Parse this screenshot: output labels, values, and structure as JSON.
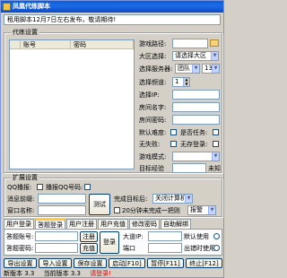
{
  "window": {
    "title": "凤凰代练脚本"
  },
  "notice": "租用脚本12月7日左右发布，敬请期待!",
  "daily_group": {
    "legend": "代练设置",
    "table_headers": [
      "账号",
      "密码"
    ],
    "fields": {
      "game_path_label": "游戏路径:",
      "region_label": "大区选择:",
      "region_value": "请选择大区",
      "server_label": "选择服务器:",
      "server_value": "团队",
      "server_num": "13",
      "channel_label": "选择频道:",
      "channel_value": "1",
      "ip_label": "选择IP:",
      "room_label": "房间名字:",
      "room_pw_label": "房间密码:",
      "default_mode_label": "默认难度:",
      "task_label": "是否任务:",
      "no_fail_label": "无失败:",
      "no_login_label": "无存登录:",
      "game_mode_label": "游戏模式:",
      "target_label": "目标经验",
      "target_unit": "未知"
    }
  },
  "ext_group": {
    "legend": "扩展设置",
    "qq_label": "QQ播报:",
    "qq_cb_label": "播报QQ号码:",
    "msg_label": "消息前缀:",
    "window_label": "窗口名称:",
    "test_button": "测试",
    "after_label": "完成目标后:",
    "after_value": "关闭计算机",
    "relogin_label": "20分钟未完成一把则",
    "relogin_value": "报警"
  },
  "tabs": [
    "用户登录",
    "答题登录",
    "用户注册",
    "用户充值",
    "修改密码",
    "自助解绑"
  ],
  "login": {
    "account_label": "答题账号:",
    "password_label": "答题密码:",
    "register_button": "注册",
    "recharge_button": "充值",
    "login_button": "登录",
    "bigip_label": "大道IP:",
    "bigip_default": "默认使用",
    "port_label": "端口",
    "time_label": "出错时使用"
  },
  "toolbar": {
    "export": "导出设置",
    "import": "导入设置",
    "save": "保存设置",
    "start": "启动[F10]",
    "pause": "暂停[F11]",
    "stop": "终止[F12]"
  },
  "status": {
    "new_version": "新版本 3.3",
    "current_version": "当前版本 3.3",
    "hint": "请登录!"
  }
}
